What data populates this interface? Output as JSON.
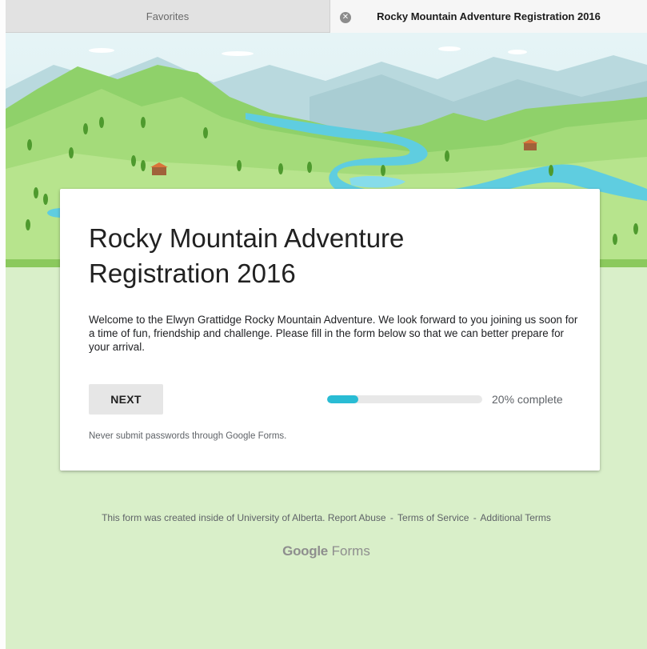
{
  "tabs": [
    {
      "label": "Favorites",
      "active": false
    },
    {
      "label": "Rocky Mountain Adventure Registration 2016",
      "active": true,
      "close_icon": "close-circle-icon"
    }
  ],
  "form": {
    "title": "Rocky Mountain Adventure Registration 2016",
    "description": "Welcome to the Elwyn Grattidge Rocky Mountain Adventure. We look forward to you joining us soon for a time of fun, friendship and challenge. Please fill in the form below so that we can better prepare for your arrival.",
    "next_label": "NEXT",
    "progress": {
      "percent": 20,
      "label": "20% complete"
    },
    "warning": "Never submit passwords through Google Forms."
  },
  "footer": {
    "created_text": "This form was created inside of University of Alberta.",
    "links": [
      "Report Abuse",
      "Terms of Service",
      "Additional Terms"
    ],
    "separator": "-",
    "brand_google": "Google",
    "brand_forms": "Forms"
  },
  "colors": {
    "background": "#d9efc9",
    "accent": "#29bcd4",
    "banner_sky": "#dff1f4",
    "banner_green": "#8fd16a"
  }
}
